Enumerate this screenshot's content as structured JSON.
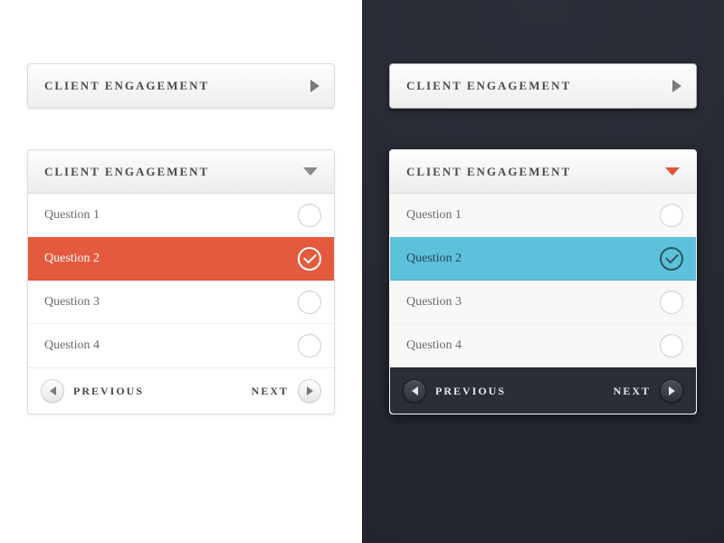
{
  "light": {
    "collapsed_title": "CLIENT ENGAGEMENT",
    "title": "CLIENT ENGAGEMENT",
    "items": [
      {
        "label": "Question 1",
        "active": false
      },
      {
        "label": "Question 2",
        "active": true
      },
      {
        "label": "Question 3",
        "active": false
      },
      {
        "label": "Question 4",
        "active": false
      }
    ],
    "prev": "PREVIOUS",
    "next": "NEXT",
    "accent": "#e45a3e"
  },
  "dark": {
    "collapsed_title": "CLIENT ENGAGEMENT",
    "title": "CLIENT ENGAGEMENT",
    "items": [
      {
        "label": "Question 1",
        "active": false
      },
      {
        "label": "Question 2",
        "active": true
      },
      {
        "label": "Question 3",
        "active": false
      },
      {
        "label": "Question 4",
        "active": false
      }
    ],
    "prev": "PREVIOUS",
    "next": "NEXT",
    "accent": "#5cc1db"
  }
}
